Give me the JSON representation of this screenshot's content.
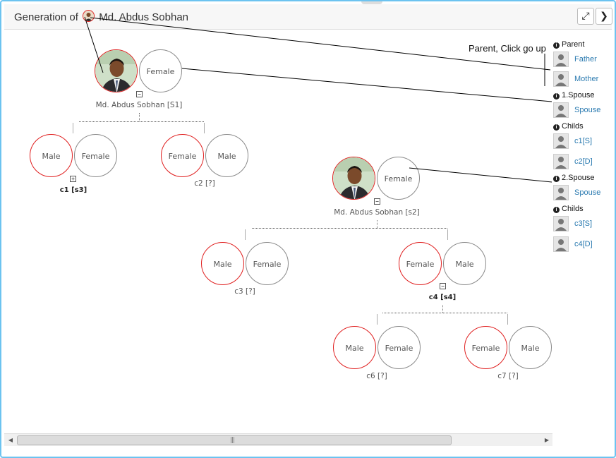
{
  "header": {
    "title_prefix": "Generation of",
    "person_name": "Md. Abdus Sobhan",
    "expand_icon": "expand-icon",
    "next_icon": "chevron-right-icon"
  },
  "note": "Parent, Click go up",
  "tree": {
    "root": {
      "partner_label": "Female",
      "caption": "Md. Abdus Sobhan [S1]",
      "toggle": "−"
    },
    "c1": {
      "a": "Male",
      "b": "Female",
      "caption": "c1 [s3]",
      "toggle": "+"
    },
    "c2": {
      "a": "Female",
      "b": "Male",
      "caption": "c2 [?]"
    },
    "s2": {
      "partner_label": "Female",
      "caption": "Md. Abdus Sobhan [s2]",
      "toggle": "−"
    },
    "c3": {
      "a": "Male",
      "b": "Female",
      "caption": "c3 [?]"
    },
    "c4": {
      "a": "Female",
      "b": "Male",
      "caption": "c4 [s4]",
      "toggle": "−"
    },
    "c6": {
      "a": "Male",
      "b": "Female",
      "caption": "c6 [?]"
    },
    "c7": {
      "a": "Female",
      "b": "Male",
      "caption": "c7 [?]"
    }
  },
  "sidebar": {
    "parent_header": "Parent",
    "father": "Father",
    "mother": "Mother",
    "spouse1_header": "1.Spouse",
    "spouse1": "Spouse",
    "childs1_header": "Childs",
    "child_c1": "c1[S]",
    "child_c2": "c2[D]",
    "spouse2_header": "2.Spouse",
    "spouse2": "Spouse",
    "childs2_header": "Childs",
    "child_c3": "c3[S]",
    "child_c4": "c4[D]"
  },
  "scrollbar": {
    "grip": "|||"
  },
  "colors": {
    "accent_border": "#6cc3f0",
    "male_highlight": "#e02020",
    "link": "#2a7ab0"
  }
}
